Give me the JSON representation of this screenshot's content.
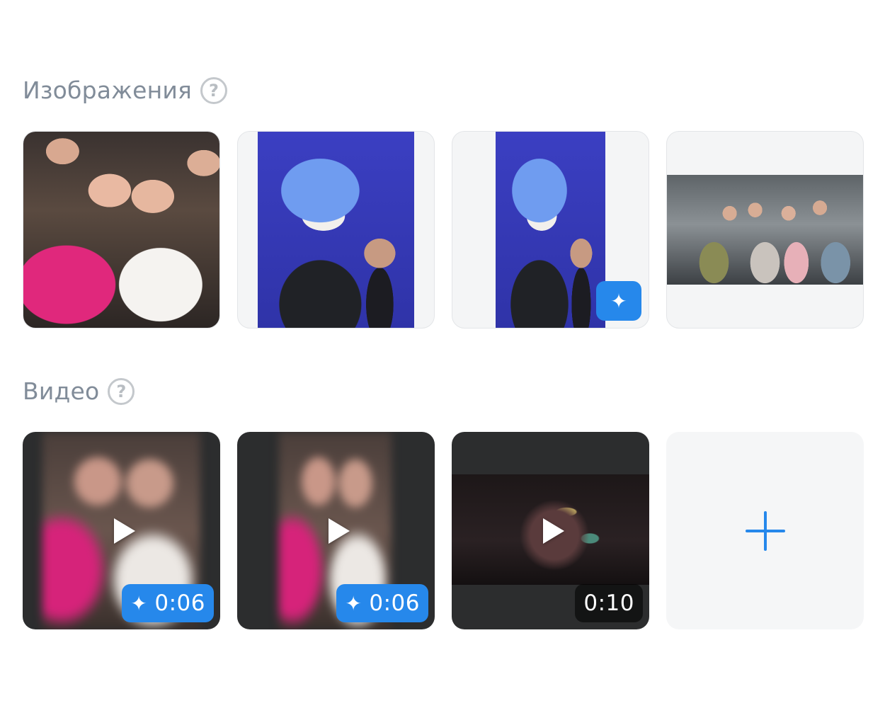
{
  "images_section": {
    "title": "Изображения",
    "help_glyph": "?"
  },
  "videos_section": {
    "title": "Видео",
    "help_glyph": "?",
    "items": [
      {
        "duration": "0:06",
        "ai": true
      },
      {
        "duration": "0:06",
        "ai": true
      },
      {
        "duration": "0:10",
        "ai": false
      }
    ],
    "add_glyph": "+"
  },
  "icons": {
    "ai_sparkle": "sparkle-icon",
    "play": "play-icon",
    "help": "help-icon",
    "add": "plus-icon"
  },
  "colors": {
    "accent": "#2688eb",
    "section_title": "#818c99",
    "tile_bg": "#f4f5f6"
  }
}
